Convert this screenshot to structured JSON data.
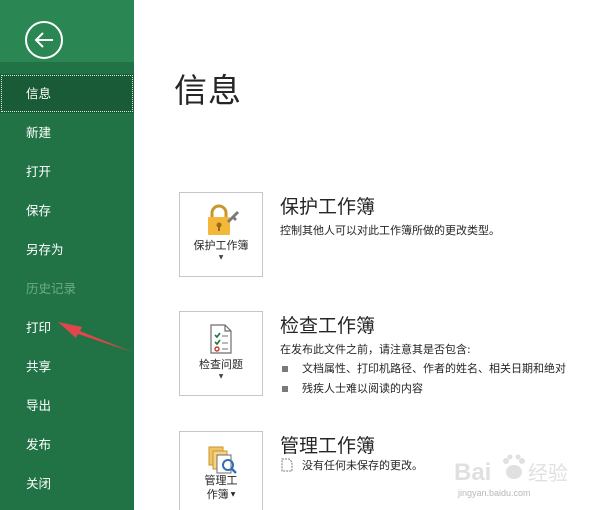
{
  "sidebar": {
    "items": [
      {
        "label": "信息",
        "state": "active"
      },
      {
        "label": "新建",
        "state": "normal"
      },
      {
        "label": "打开",
        "state": "normal"
      },
      {
        "label": "保存",
        "state": "normal"
      },
      {
        "label": "另存为",
        "state": "normal"
      },
      {
        "label": "历史记录",
        "state": "disabled"
      },
      {
        "label": "打印",
        "state": "normal"
      },
      {
        "label": "共享",
        "state": "normal"
      },
      {
        "label": "导出",
        "state": "normal"
      },
      {
        "label": "发布",
        "state": "normal"
      },
      {
        "label": "关闭",
        "state": "normal"
      }
    ]
  },
  "main": {
    "title": "信息",
    "protect": {
      "button_label": "保护工作簿",
      "title": "保护工作簿",
      "description": "控制其他人可以对此工作簿所做的更改类型。"
    },
    "inspect": {
      "button_label": "检查问题",
      "title": "检查工作簿",
      "description": "在发布此文件之前，请注意其是否包含:",
      "items": [
        "文档属性、打印机路径、作者的姓名、相关日期和绝对",
        "残疾人士难以阅读的内容"
      ]
    },
    "manage": {
      "button_label_1": "管理工",
      "button_label_2": "作簿",
      "title": "管理工作簿",
      "status": "没有任何未保存的更改。"
    }
  },
  "watermark": {
    "text": "Bai 经验",
    "sub": "jingyan.baidu.com"
  },
  "colors": {
    "sidebar": "#217346",
    "sidebar_active": "#195a37",
    "annotation_arrow": "#e0474c"
  },
  "icons": [
    "back-arrow-icon",
    "lock-icon",
    "inspect-document-icon",
    "manage-versions-icon",
    "document-icon"
  ]
}
